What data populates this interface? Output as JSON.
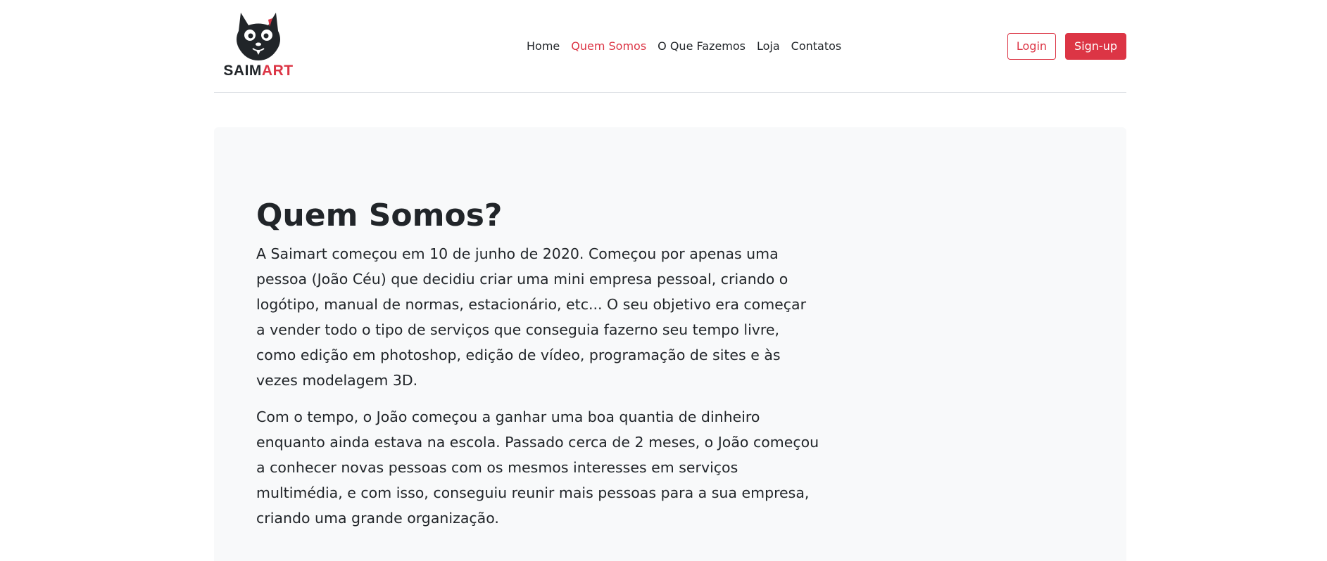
{
  "brand": {
    "logo_icon": "cat-face-icon",
    "name_part1": "SAIM",
    "name_part2": "ART",
    "accent_color": "#dc3545"
  },
  "nav": {
    "items": [
      {
        "label": "Home",
        "active": false
      },
      {
        "label": "Quem Somos",
        "active": true
      },
      {
        "label": "O Que Fazemos",
        "active": false
      },
      {
        "label": "Loja",
        "active": false
      },
      {
        "label": "Contatos",
        "active": false
      }
    ]
  },
  "auth": {
    "login_label": "Login",
    "signup_label": "Sign-up"
  },
  "hero": {
    "title": "Quem Somos?",
    "paragraphs": [
      "A Saimart começou em 10 de junho de 2020. Começou por apenas uma pessoa (João Céu) que decidiu criar uma mini empresa pessoal, criando o logótipo, manual de normas, estacionário, etc... O seu objetivo era começar a vender todo o tipo de serviços que conseguia fazerno seu tempo livre, como edição em photoshop, edição de vídeo, programação de sites e às vezes modelagem 3D.",
      "Com o tempo, o João começou a ganhar uma boa quantia de dinheiro enquanto ainda estava na escola. Passado cerca de 2 meses, o João começou a conhecer novas pessoas com os mesmos interesses em serviços multimédia, e com isso, conseguiu reunir mais pessoas para a sua empresa, criando uma grande organização."
    ]
  }
}
